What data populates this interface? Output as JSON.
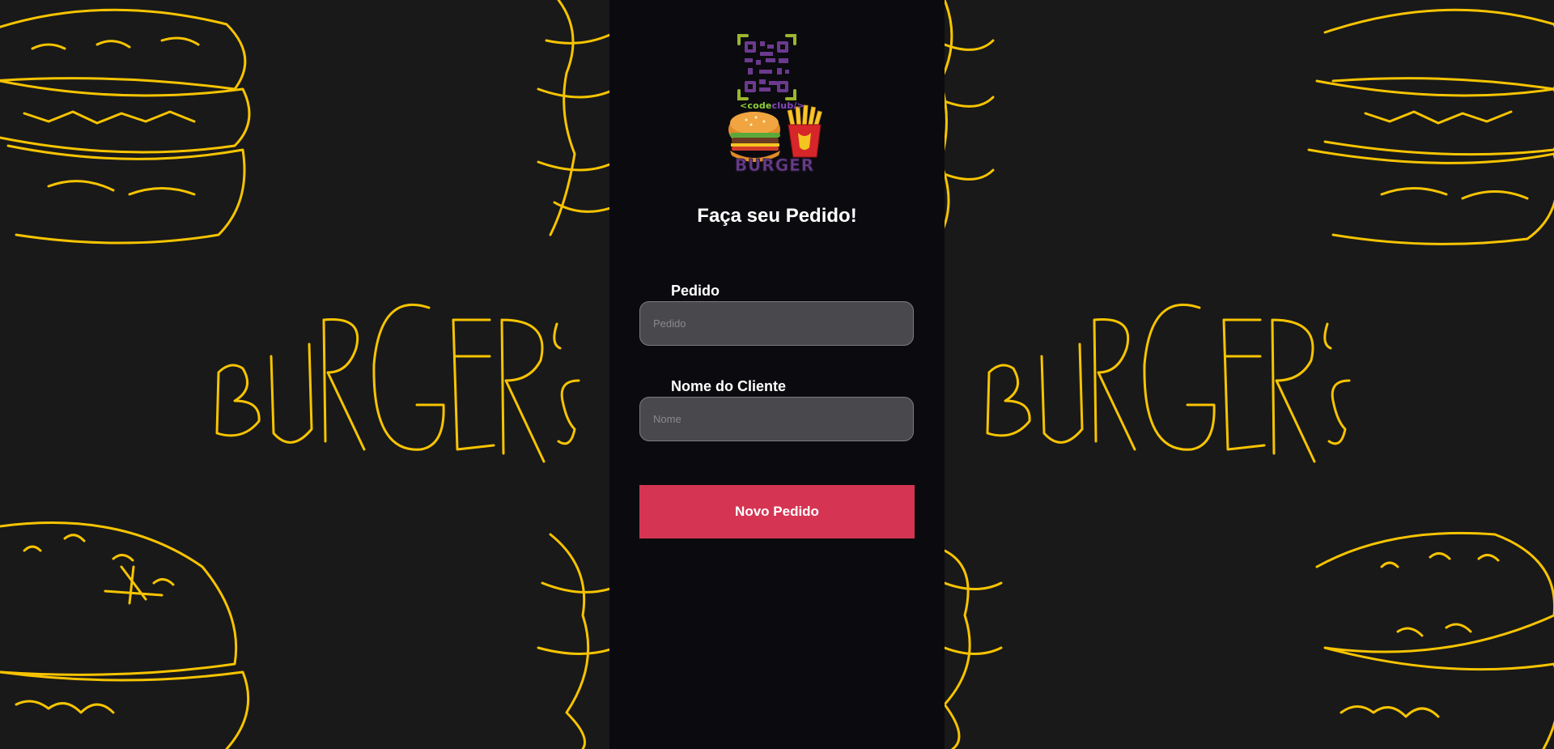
{
  "background": {
    "wordmark": "BURGER's",
    "color": "#f7c400",
    "base_color": "#191919"
  },
  "logo": {
    "code_open": "<",
    "code_word": "code",
    "club_word": "club",
    "code_close": "/>",
    "burger_word": "BURGER",
    "qr_color": "#6b3a8f",
    "frame_color": "#9bb52e"
  },
  "title": "Faça seu Pedido!",
  "form": {
    "order_label": "Pedido",
    "order_placeholder": "Pedido",
    "order_value": "",
    "client_label": "Nome do Cliente",
    "client_placeholder": "Nome",
    "client_value": "",
    "submit_label": "Novo Pedido"
  },
  "colors": {
    "panel": "#0b0b0f",
    "input_bg": "#49484d",
    "accent": "#d53553"
  }
}
